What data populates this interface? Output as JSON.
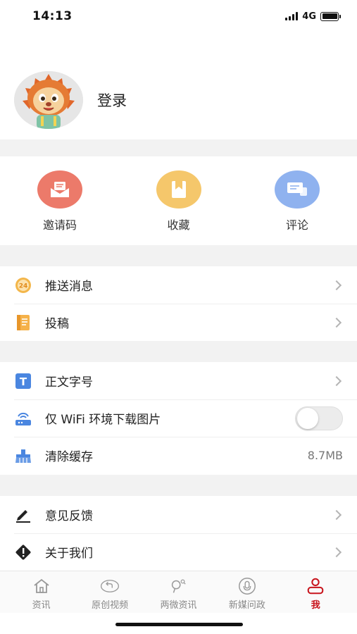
{
  "status_bar": {
    "time": "14:13",
    "network": "4G"
  },
  "profile": {
    "login_label": "登录"
  },
  "quick_actions": [
    {
      "label": "邀请码",
      "color": "#ec7a6a",
      "icon": "envelope-icon"
    },
    {
      "label": "收藏",
      "color": "#f5c76b",
      "icon": "bookmark-icon"
    },
    {
      "label": "评论",
      "color": "#8fb2ef",
      "icon": "chat-icon"
    }
  ],
  "section1": [
    {
      "label": "推送消息",
      "icon": "clock-24-icon"
    },
    {
      "label": "投稿",
      "icon": "notebook-icon"
    }
  ],
  "section2": {
    "font_size": {
      "label": "正文字号"
    },
    "wifi_only": {
      "label": "仅 WiFi 环境下载图片",
      "enabled": false
    },
    "clear_cache": {
      "label": "清除缓存",
      "value": "8.7MB"
    }
  },
  "section3": [
    {
      "label": "意见反馈",
      "icon": "pencil-icon"
    },
    {
      "label": "关于我们",
      "icon": "warning-diamond-icon"
    }
  ],
  "tabbar": [
    {
      "label": "资讯",
      "active": false
    },
    {
      "label": "原创视频",
      "active": false
    },
    {
      "label": "两微资讯",
      "active": false
    },
    {
      "label": "新媒问政",
      "active": false
    },
    {
      "label": "我",
      "active": true
    }
  ],
  "colors": {
    "accent": "#c8141c",
    "gap": "#f2f2f2"
  }
}
